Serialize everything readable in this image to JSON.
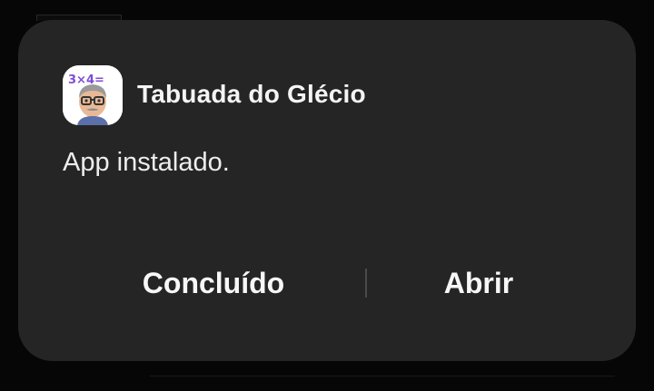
{
  "dialog": {
    "app_name": "Tabuada do Glécio",
    "app_icon": "cartoon-avatar-with-glasses-icon",
    "message": "App instalado.",
    "buttons": {
      "done_label": "Concluído",
      "open_label": "Abrir"
    }
  },
  "colors": {
    "dialog_background": "#252525",
    "text_primary": "#f4f4f4",
    "divider": "#4a4a4a",
    "icon_background": "#ffffff",
    "icon_digits_purple": "#7c4dd8"
  }
}
